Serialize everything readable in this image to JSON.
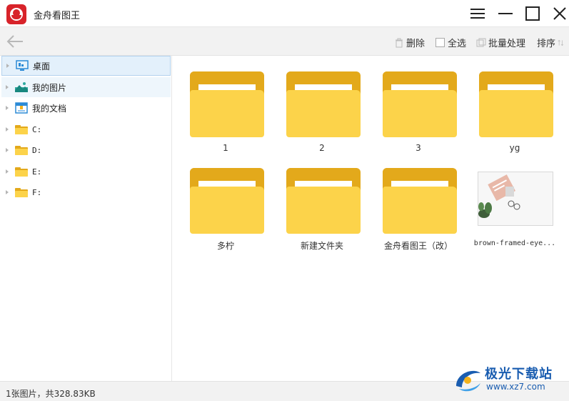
{
  "window": {
    "title": "金舟看图王"
  },
  "toolbar": {
    "delete_label": "删除",
    "select_all_label": "全选",
    "batch_label": "批量处理",
    "sort_label": "排序"
  },
  "sidebar": {
    "items": [
      {
        "label": "桌面",
        "icon": "desktop-icon",
        "state": "selected"
      },
      {
        "label": "我的图片",
        "icon": "pictures-icon",
        "state": "hover"
      },
      {
        "label": "我的文档",
        "icon": "documents-icon",
        "state": "normal"
      },
      {
        "label": "C:",
        "icon": "drive-folder-icon",
        "state": "normal"
      },
      {
        "label": "D:",
        "icon": "drive-folder-icon",
        "state": "normal"
      },
      {
        "label": "E:",
        "icon": "drive-folder-icon",
        "state": "normal"
      },
      {
        "label": "F:",
        "icon": "drive-folder-icon",
        "state": "normal"
      }
    ]
  },
  "grid": {
    "items": [
      {
        "label": "1",
        "type": "folder"
      },
      {
        "label": "2",
        "type": "folder"
      },
      {
        "label": "3",
        "type": "folder"
      },
      {
        "label": "yg",
        "type": "folder"
      },
      {
        "label": "多柠",
        "type": "folder"
      },
      {
        "label": "新建文件夹",
        "type": "folder"
      },
      {
        "label": "金舟看图王（改）",
        "type": "folder"
      },
      {
        "label": "brown-framed-eye...",
        "type": "image"
      }
    ]
  },
  "status": {
    "text": "1张图片，共328.83KB"
  },
  "watermark": {
    "title": "极光下载站",
    "url": "www.xz7.com"
  },
  "colors": {
    "accent": "#d8232a",
    "folder_front": "#fcd34a",
    "folder_back": "#e3a91b",
    "selection": "#e3f0fb",
    "watermark": "#1a5db0"
  }
}
